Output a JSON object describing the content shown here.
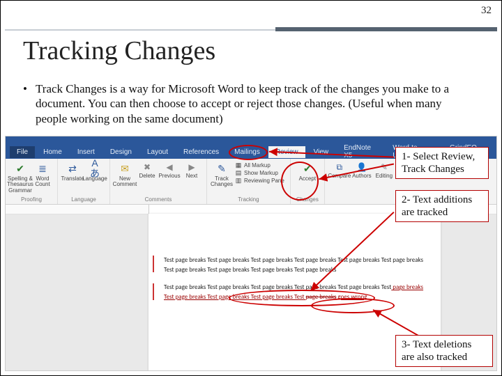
{
  "page_number": "32",
  "title": "Tracking Changes",
  "bullet": {
    "marker": "•",
    "text": "Track Changes is a way for Microsoft Word to keep track of the changes you make to a document. You can then choose to accept or reject those changes. (Useful when many people working on the same document)"
  },
  "word": {
    "tabs": {
      "file": "File",
      "home": "Home",
      "insert": "Insert",
      "design": "Design",
      "layout": "Layout",
      "references": "References",
      "mailings": "Mailings",
      "review": "Review",
      "view": "View",
      "endnote": "EndNote X5",
      "wordtolatex": "Word-to-LaTeX",
      "grindeq": "GrindEQ Math"
    },
    "groups": {
      "proofing": {
        "spelling": "Spelling & Thesaurus Grammar",
        "wordcount": "Word Count",
        "label": "Proofing"
      },
      "language": {
        "translate": "Translate",
        "language": "Language",
        "label": "Language"
      },
      "comments": {
        "new": "New Comment",
        "delete": "Delete",
        "previous": "Previous",
        "next": "Next",
        "label": "Comments"
      },
      "tracking": {
        "track": "Track Changes",
        "allmarkup": "All Markup",
        "showmarkup": "Show Markup",
        "reviewpane": "Reviewing Pane",
        "label": "Tracking"
      },
      "changes": {
        "accept": "Accept",
        "label": "Changes"
      },
      "compare": {
        "compare": "Compare",
        "authors": "Authors",
        "editing": "Editing"
      }
    },
    "doc_lines": {
      "p1": "Test page breaks Test page breaks Test page breaks Test page breaks Test page breaks Test page breaks Test page breaks Test page breaks Test page breaks Test page breaks",
      "p2a": "Test page breaks Test page breaks Test page breaks Test page breaks Test page breaks Test",
      "p2b": " page breaks Test page breaks Test page breaks Test page breaks Test ",
      "p2del": "page breaks",
      "p2ins": "goes wrong"
    }
  },
  "callouts": {
    "c1": "1- Select Review, Track Changes",
    "c2": "2- Text additions are tracked",
    "c3": "3- Text deletions are also tracked"
  }
}
